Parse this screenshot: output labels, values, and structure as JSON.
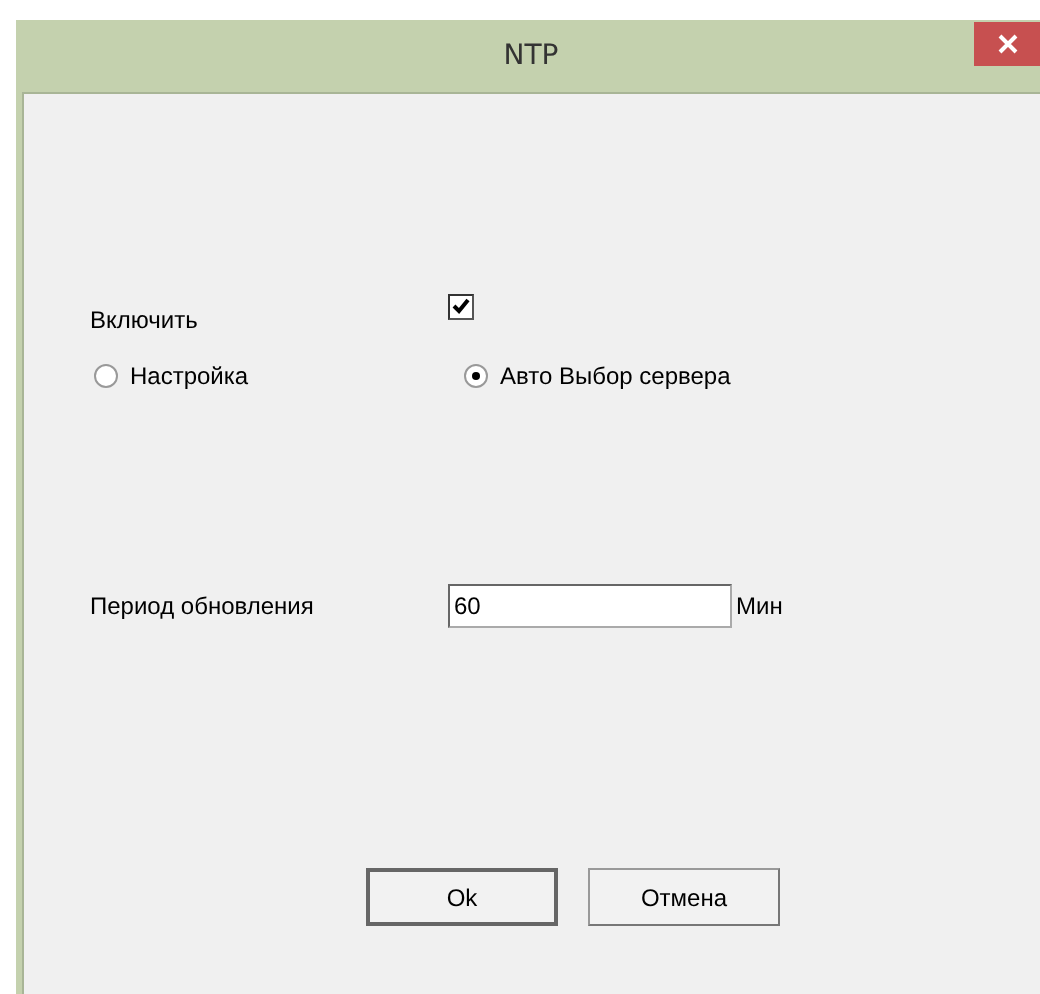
{
  "window": {
    "title": "NTP"
  },
  "enable": {
    "label": "Включить",
    "checked": true
  },
  "mode": [
    {
      "label": "Настройка",
      "selected": false
    },
    {
      "label": "Авто Выбор сервера",
      "selected": true
    }
  ],
  "update_period": {
    "label": "Период обновления",
    "value": "60",
    "unit": "Мин"
  },
  "buttons": [
    {
      "label": "Ok"
    },
    {
      "label": "Отмена"
    }
  ]
}
